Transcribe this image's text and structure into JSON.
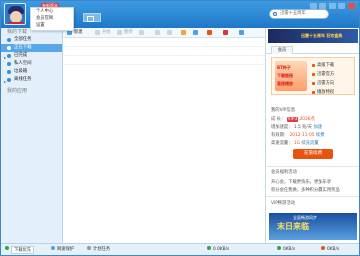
{
  "app": {
    "new_badge": "有新版本",
    "user_menu": [
      "个人中心",
      "会员官网",
      "设置"
    ],
    "search_placeholder": "迅雷十五周年"
  },
  "sidebar": {
    "section_title": "我的下载",
    "items": [
      {
        "label": "全部任务"
      },
      {
        "label": "正在下载"
      },
      {
        "label": "已完成"
      },
      {
        "label": "私人空间"
      },
      {
        "label": "垃圾箱"
      },
      {
        "label": "离线任务"
      }
    ],
    "footer_title": "我的应用"
  },
  "toolbar": {
    "new_label": "新建",
    "start_label": "开始",
    "pause_label": "暂停"
  },
  "right_panel": {
    "top_ad_text": "迅雷十五周年 狂欢盛典",
    "tab_member": "会员",
    "promo": {
      "art_line1": "BT种子",
      "art_line2": "下载链接",
      "art_line3": "直接播放",
      "links": [
        "高级下载",
        "迅雷官方",
        "迅雷方向",
        "播放特权"
      ]
    },
    "vip": {
      "title": "我的VIP信息",
      "growth_label": "成  长：",
      "growth_value": "2036点",
      "growth_badge": "VIP3",
      "speed_label": "增加速度：",
      "speed_value": "1.5 兆/天",
      "speed_link": "加速",
      "expire_label": "有效期：",
      "expire_value": "2012-11-05",
      "expire_link": "续费",
      "recharge_label": "高速流量：",
      "recharge_value": "1G",
      "recharge_link": "续充流量",
      "button_label": "充值续费"
    },
    "activity_title": "会员福利活动",
    "activity_line1": "开心会，下载更快乐，更加乐享",
    "activity_line2": "积分会任我换，多种积分赢实用奖品",
    "vip_activity_title": "VIP畅游活动",
    "bottom_ad_small": "全面畅游同步",
    "bottom_ad_big": "末日来临"
  },
  "statusbar": {
    "download_tab": "下载优先",
    "network_tab": "网速保护",
    "schedule_label": "计划任务",
    "speed1": "0.0KB/s",
    "speed2": "0KB/s",
    "speed3": "0KB/s"
  }
}
